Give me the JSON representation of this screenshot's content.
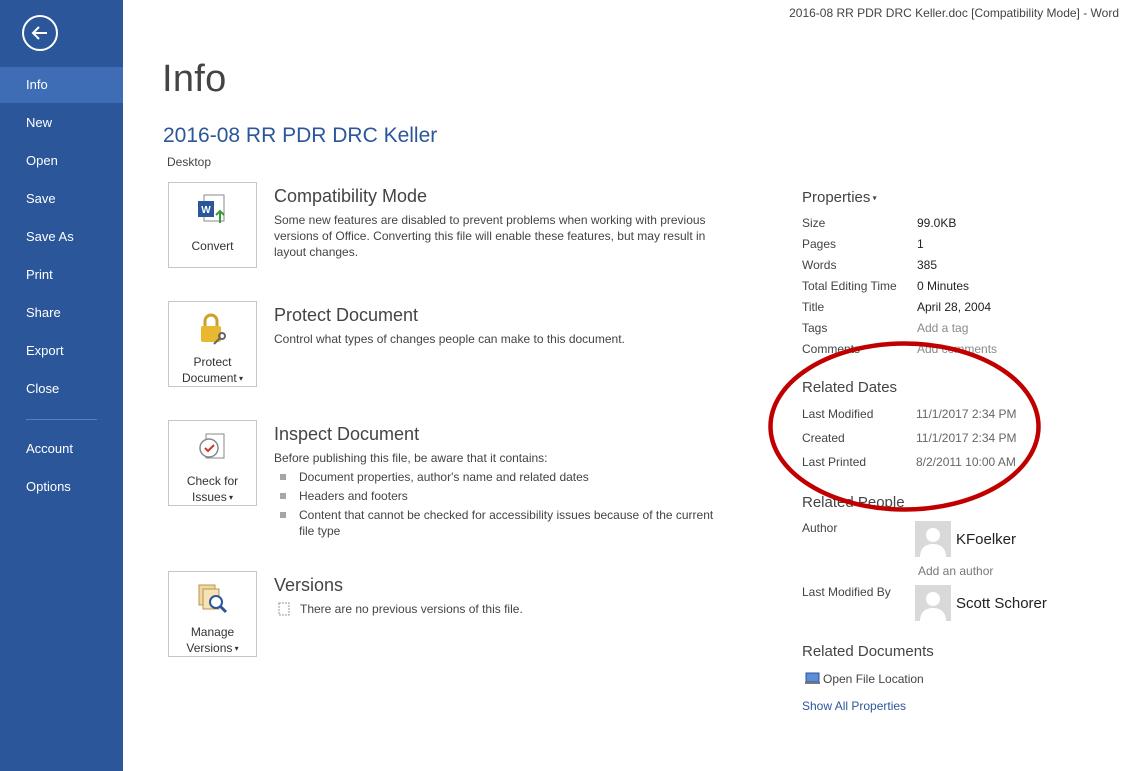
{
  "window_title": "2016-08 RR PDR DRC Keller.doc [Compatibility Mode] - Word",
  "nav": {
    "items": [
      {
        "label": "Info",
        "active": true
      },
      {
        "label": "New"
      },
      {
        "label": "Open"
      },
      {
        "label": "Save"
      },
      {
        "label": "Save As"
      },
      {
        "label": "Print"
      },
      {
        "label": "Share"
      },
      {
        "label": "Export"
      },
      {
        "label": "Close"
      },
      {
        "label": "Account"
      },
      {
        "label": "Options"
      }
    ]
  },
  "page_title": "Info",
  "document": {
    "title": "2016-08 RR PDR DRC Keller",
    "location": "Desktop"
  },
  "sections": {
    "compatibility": {
      "button_label": "Convert",
      "title": "Compatibility Mode",
      "text": "Some new features are disabled to prevent problems when working with previous versions of Office. Converting this file will enable these features, but may result in layout changes."
    },
    "protect": {
      "button_label_1": "Protect",
      "button_label_2": "Document",
      "title": "Protect Document",
      "text": "Control what types of changes people can make to this document."
    },
    "inspect": {
      "button_label_1": "Check for",
      "button_label_2": "Issues",
      "title": "Inspect Document",
      "text": "Before publishing this file, be aware that it contains:",
      "bullets": [
        "Document properties, author's name and related dates",
        "Headers and footers",
        "Content that cannot be checked for accessibility issues because of the current file type"
      ]
    },
    "versions": {
      "button_label_1": "Manage",
      "button_label_2": "Versions",
      "title": "Versions",
      "text": "There are no previous versions of this file."
    }
  },
  "properties": {
    "title": "Properties",
    "rows": [
      {
        "label": "Size",
        "value": "99.0KB"
      },
      {
        "label": "Pages",
        "value": "1"
      },
      {
        "label": "Words",
        "value": "385"
      },
      {
        "label": "Total Editing Time",
        "value": "0 Minutes"
      },
      {
        "label": "Title",
        "value": "April 28, 2004"
      },
      {
        "label": "Tags",
        "value": "Add a tag"
      },
      {
        "label": "Comments",
        "value": "Add comments"
      }
    ]
  },
  "related_dates": {
    "title": "Related Dates",
    "rows": [
      {
        "label": "Last Modified",
        "value": "11/1/2017 2:34 PM"
      },
      {
        "label": "Created",
        "value": "11/1/2017 2:34 PM"
      },
      {
        "label": "Last Printed",
        "value": "8/2/2011 10:00 AM"
      }
    ]
  },
  "related_people": {
    "title": "Related People",
    "author_label": "Author",
    "author_name": "KFoelker",
    "add_author": "Add an author",
    "last_modified_by_label": "Last Modified By",
    "last_modified_by_name": "Scott Schorer"
  },
  "related_documents": {
    "title": "Related Documents",
    "open_file_location": "Open File Location",
    "show_all": "Show All Properties"
  },
  "colors": {
    "sidebar": "#2b579a",
    "accent": "#2b579a",
    "annotation": "#c00000"
  }
}
